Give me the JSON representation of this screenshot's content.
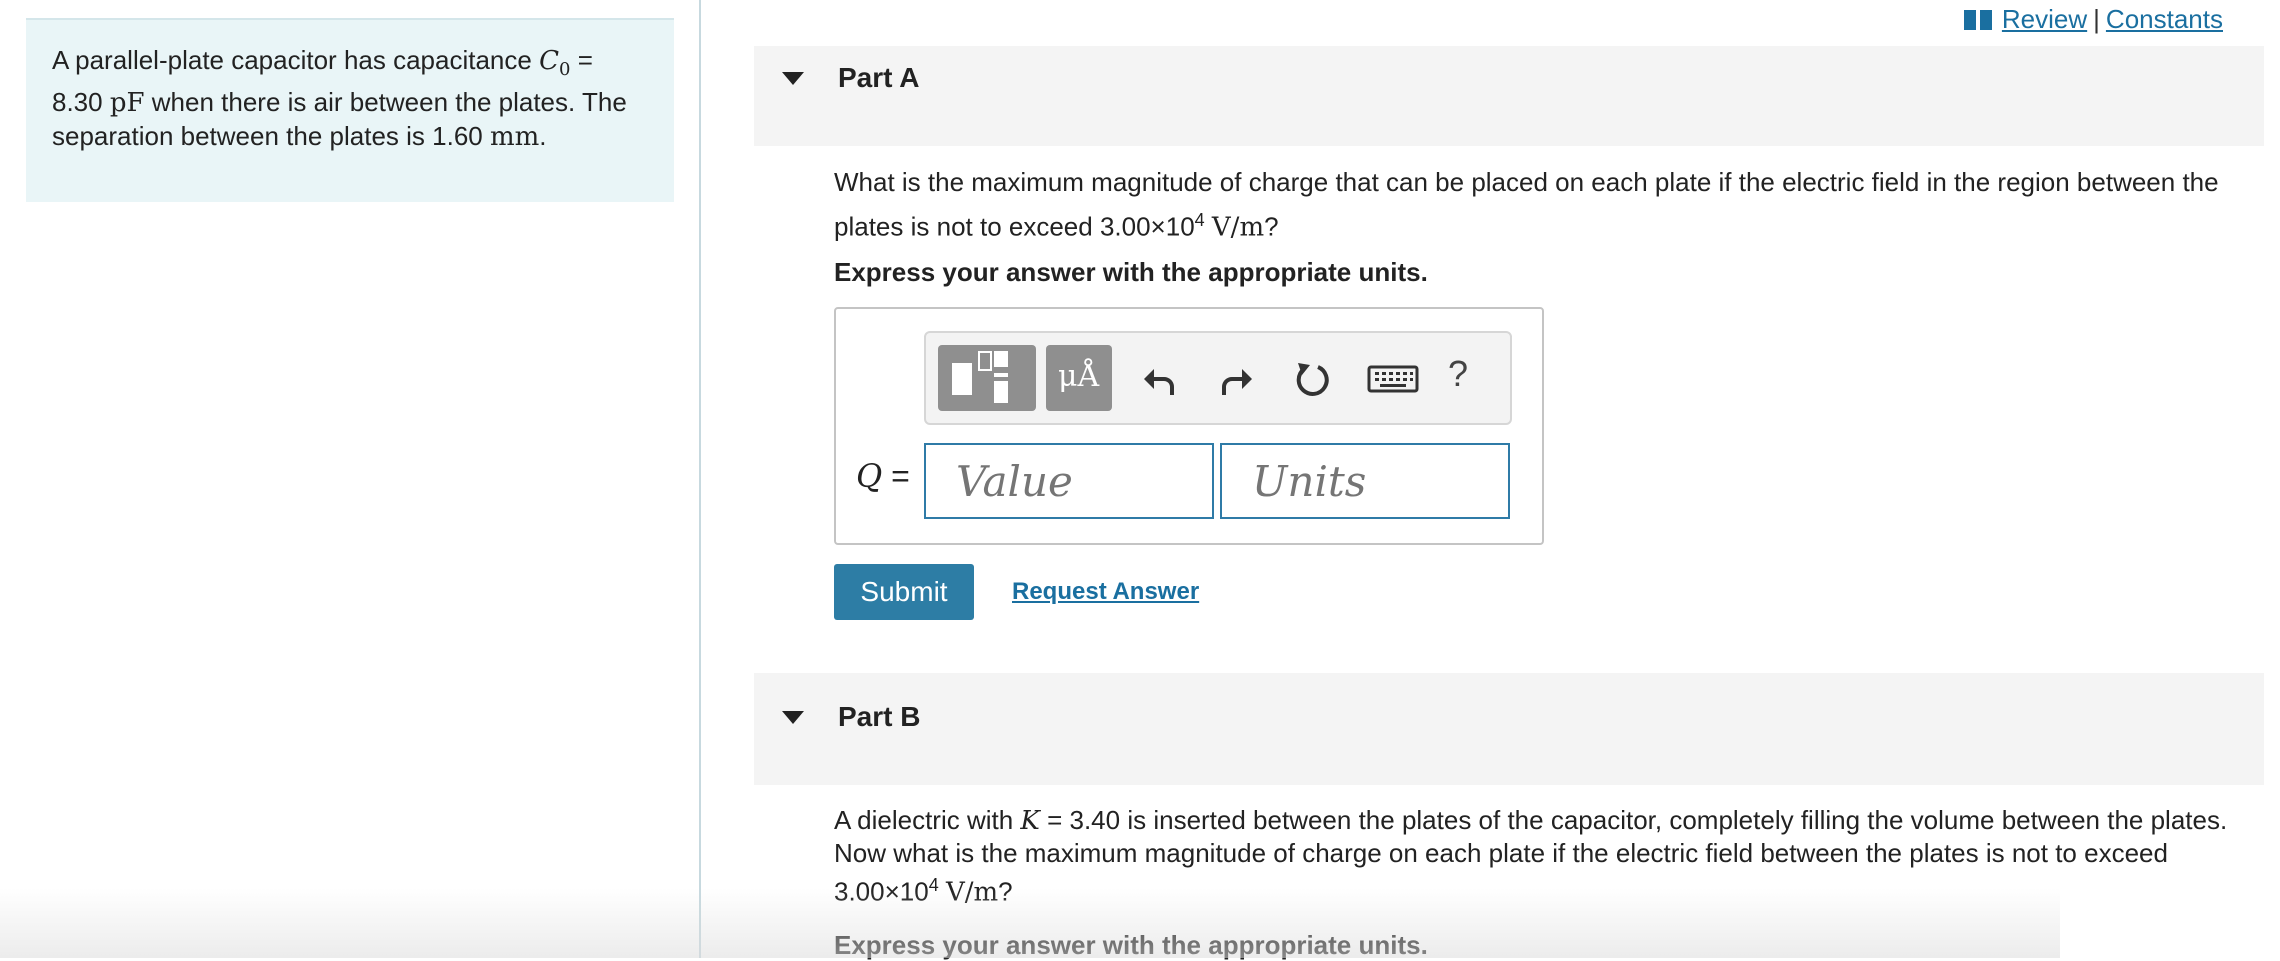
{
  "toplinks": {
    "review": "Review",
    "separator": "|",
    "constants": "Constants"
  },
  "intro": {
    "t1": "A parallel-plate capacitor has capacitance",
    "c_symbol": "C",
    "c_sub": "0",
    "c_eq": "= 8.30",
    "c_unit": "pF",
    "t2": "when there is air between the plates. The separation between the plates is 1.60",
    "sep_unit": "mm",
    "t3": "."
  },
  "partA": {
    "title": "Part A",
    "question_1": "What is the maximum magnitude of charge that can be placed on each plate if the electric field in the region between the plates is not to exceed 3.00×10",
    "question_exp": "4",
    "question_unit": "V/m",
    "question_end": "?",
    "instruction": "Express your answer with the appropriate units.",
    "toolbar": {
      "units_button": "μÅ",
      "help": "?"
    },
    "q_symbol": "Q",
    "q_eq": "=",
    "value_placeholder": "Value",
    "units_placeholder": "Units",
    "submit": "Submit",
    "request_answer": "Request Answer"
  },
  "partB": {
    "title": "Part B",
    "q1": "A dielectric with",
    "k_symbol": "K",
    "q2": "= 3.40 is inserted between the plates of the capacitor, completely filling the volume between the plates. Now what is the maximum magnitude of charge on each plate if the electric field between the plates is not to exceed 3.00×10",
    "exp": "4",
    "unit": "V/m",
    "end": "?",
    "instruction": "Express your answer with the appropriate units."
  }
}
